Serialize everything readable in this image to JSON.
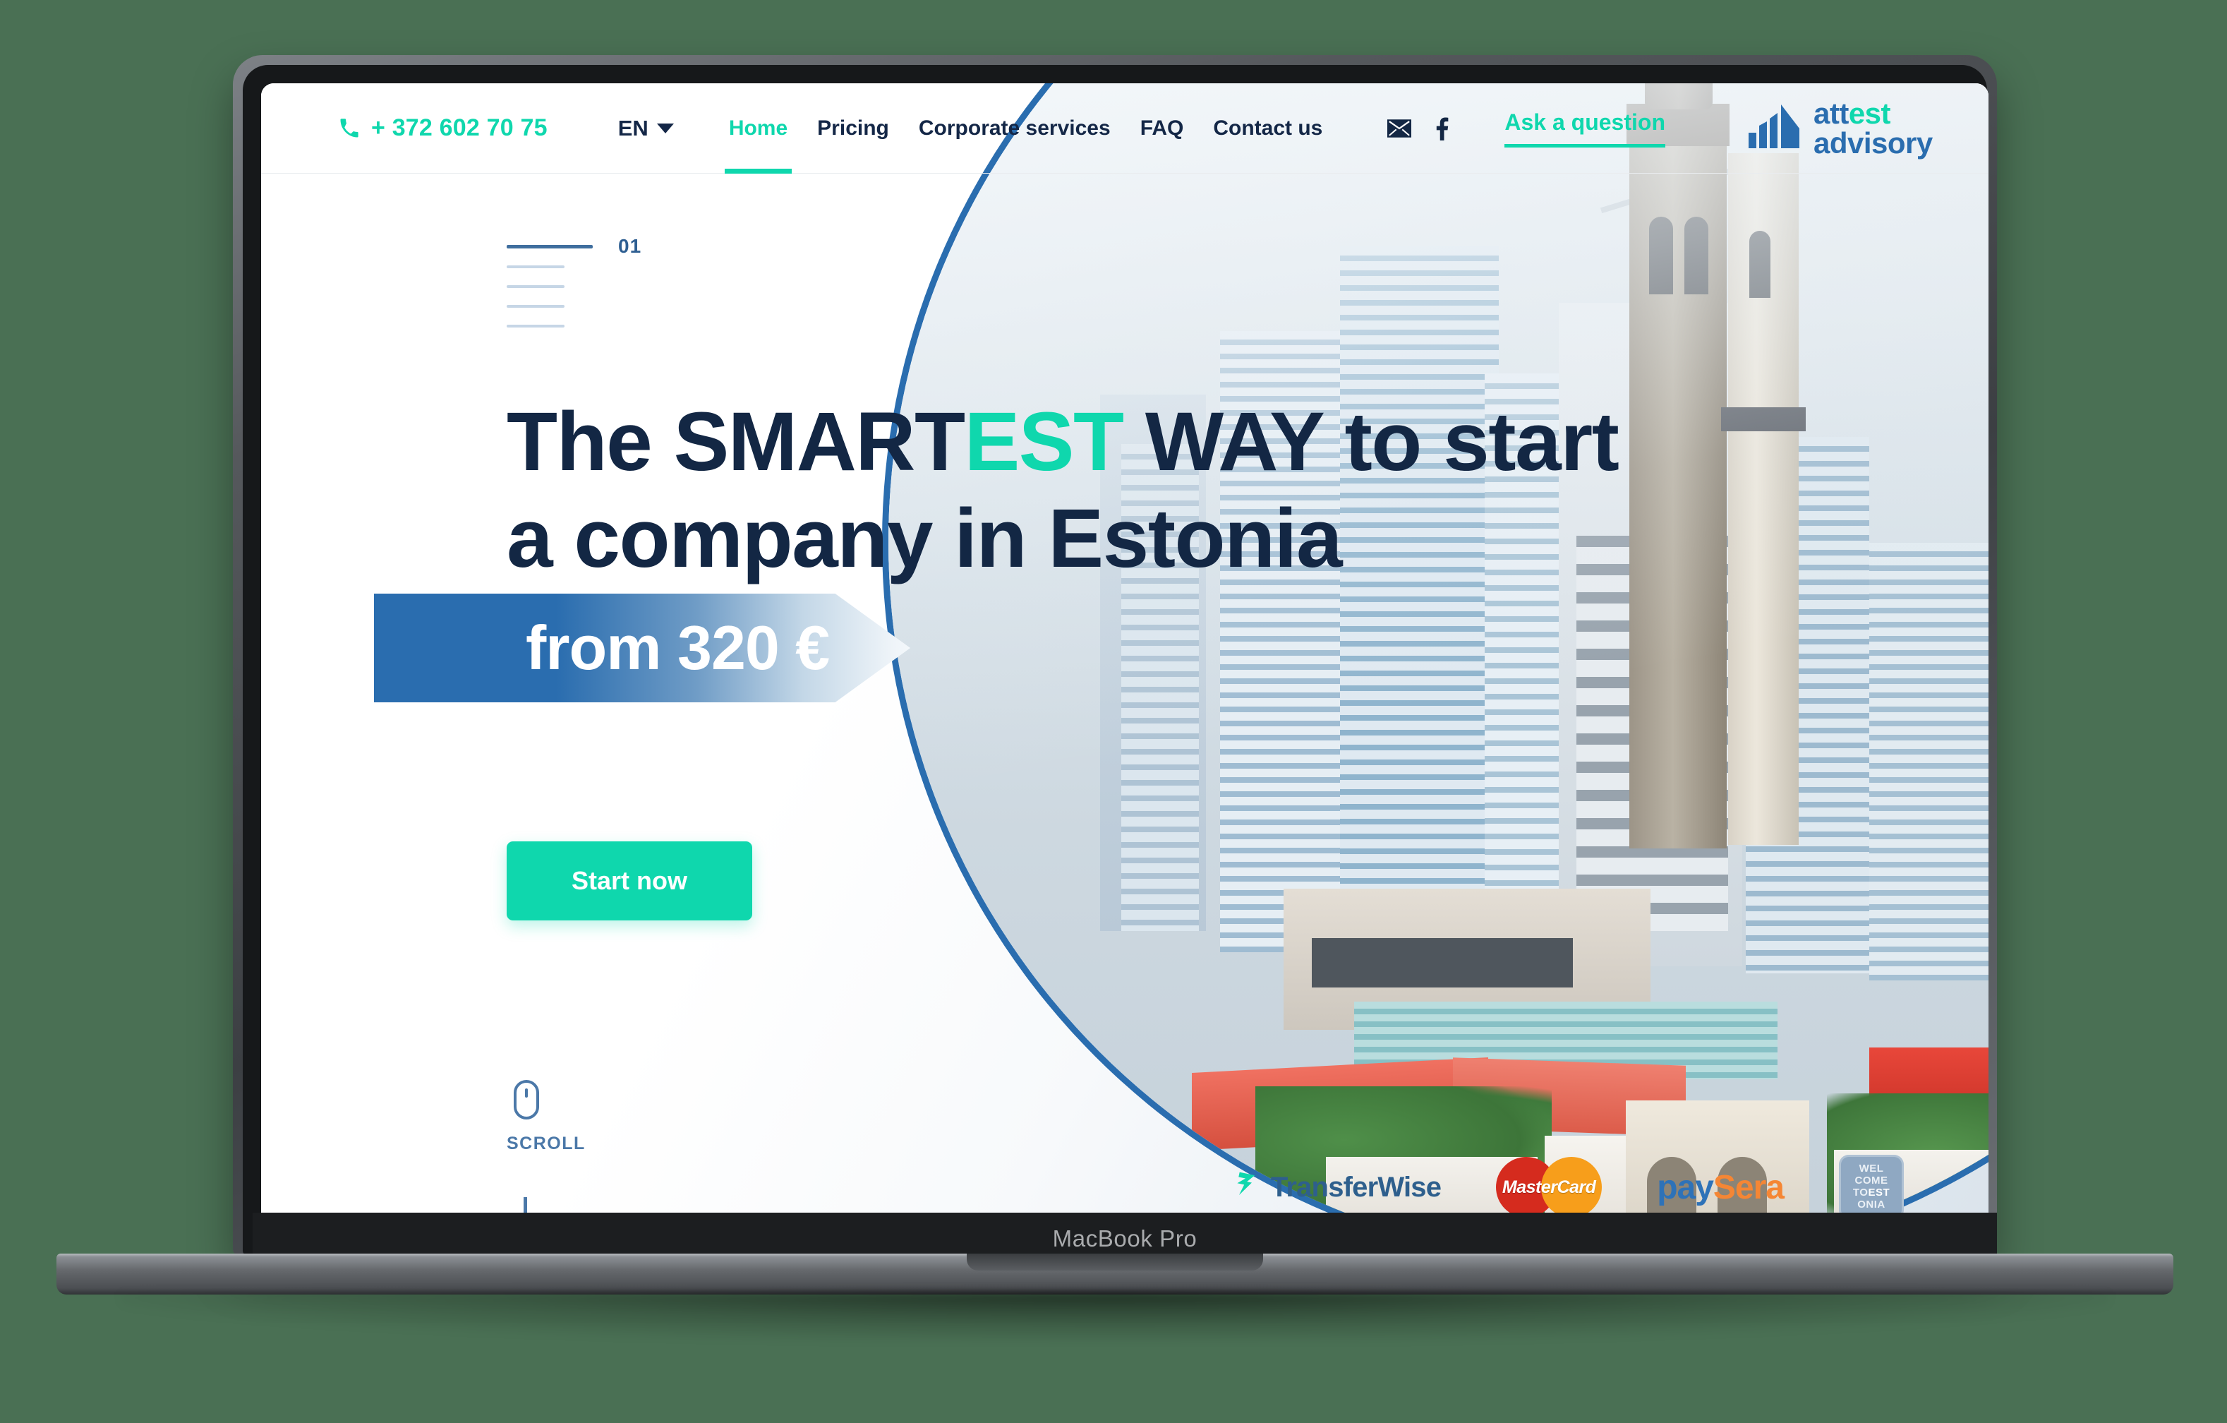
{
  "device": {
    "brand_label": "MacBook Pro"
  },
  "page": {
    "background_color": "#4a7054",
    "accent_teal": "#0fd7ad",
    "accent_blue": "#2a6daf",
    "headline_navy": "#132744"
  },
  "header": {
    "phone_icon": "phone-icon",
    "phone_number": "+ 372 602 70 75",
    "language": {
      "current": "EN",
      "caret_icon": "chevron-down-icon"
    },
    "nav": [
      {
        "label": "Home",
        "active": true
      },
      {
        "label": "Pricing",
        "active": false
      },
      {
        "label": "Corporate services",
        "active": false
      },
      {
        "label": "FAQ",
        "active": false
      },
      {
        "label": "Contact us",
        "active": false
      }
    ],
    "social": [
      {
        "name": "email-icon",
        "glyph": "✉"
      },
      {
        "name": "facebook-icon",
        "glyph": "f"
      }
    ],
    "ask_question_label": "Ask a question",
    "logo": {
      "icon": "attest-bars-logo-icon",
      "line1_part1": "att",
      "line1_part2": "est",
      "line2": "advisory"
    }
  },
  "hero": {
    "slide_indicator": {
      "number": "01",
      "ticks": 5,
      "active_index": 0
    },
    "headline": {
      "line1_a": "The SMART",
      "line1_highlight": "EST",
      "line1_b": " WAY to start",
      "line2": "a company in Estonia"
    },
    "price_banner": "from 320 €",
    "cta_label": "Start now",
    "scroll_hint": {
      "icon": "mouse-scroll-icon",
      "label": "SCROLL"
    }
  },
  "partners": [
    {
      "name": "transferwise-logo",
      "label": "TransferWise"
    },
    {
      "name": "mastercard-logo",
      "label": "MasterCard"
    },
    {
      "name": "paysera-logo",
      "label_blue": "pay",
      "label_orange": "Sera"
    },
    {
      "name": "welcome-to-estonia-logo",
      "l1": "WEL",
      "l2": "COME",
      "l3a": "TO",
      "l3b": "EST",
      "l4": "ONIA"
    }
  ]
}
